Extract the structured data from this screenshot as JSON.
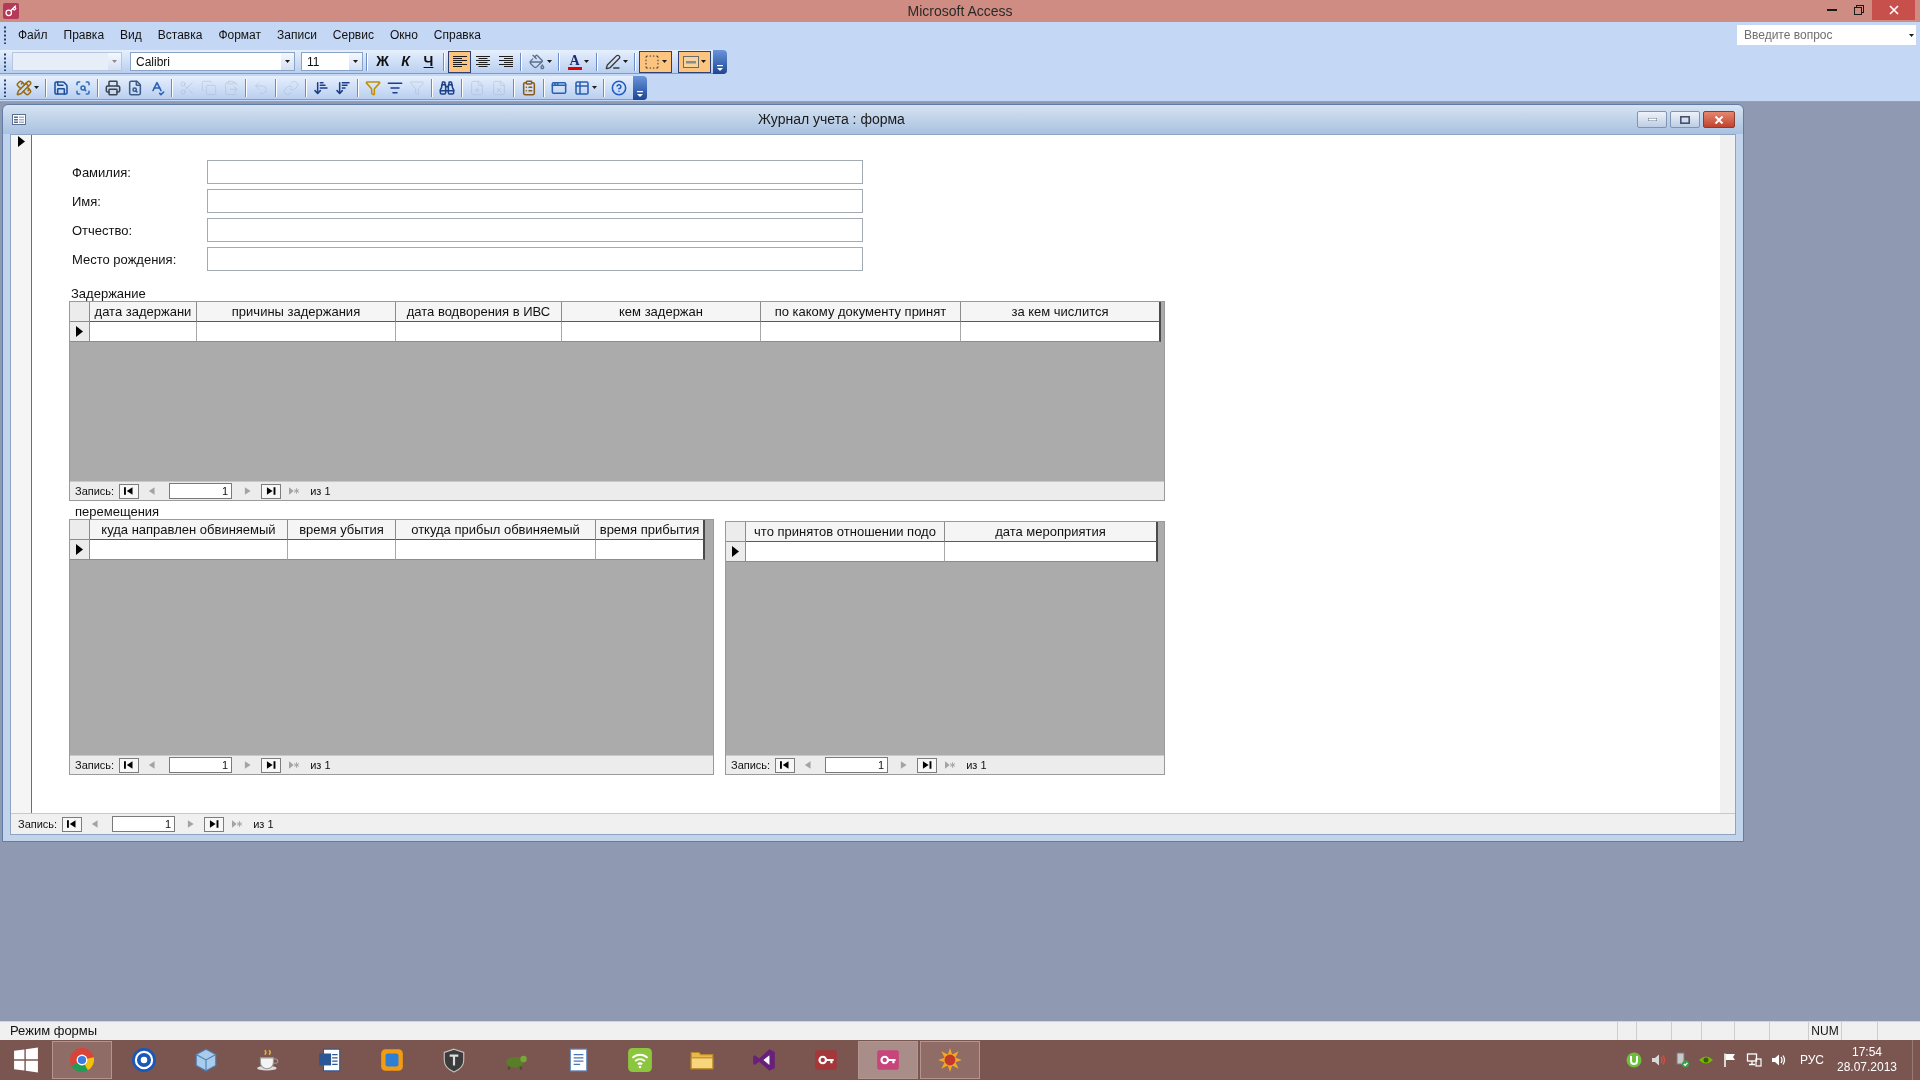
{
  "window": {
    "title": "Microsoft Access"
  },
  "menu_bar": {
    "items": [
      "Файл",
      "Правка",
      "Вид",
      "Вставка",
      "Формат",
      "Записи",
      "Сервис",
      "Окно",
      "Справка"
    ],
    "question_box": {
      "placeholder": "Введите вопрос"
    }
  },
  "formatting_toolbar": {
    "object_box": {
      "disabled": true
    },
    "font_box": {
      "value": "Calibri"
    },
    "size_box": {
      "value": "11"
    },
    "style_buttons": [
      {
        "kind": "bold",
        "label": "Ж",
        "pressed": false
      },
      {
        "kind": "italic",
        "label": "К",
        "pressed": false
      },
      {
        "kind": "underline",
        "label": "Ч",
        "pressed": false
      }
    ],
    "align_buttons": [
      {
        "pressed": true
      },
      {
        "pressed": false
      },
      {
        "pressed": false
      }
    ],
    "color_buttons": [
      {
        "pressed": false
      },
      {
        "pressed": false,
        "label": "A"
      },
      {
        "pressed": false
      },
      {
        "pressed": true
      },
      {
        "pressed": true
      }
    ]
  },
  "database_toolbar": {
    "buttons": [
      {
        "disabled": false
      },
      {
        "disabled": false
      },
      {
        "disabled": false
      },
      {
        "disabled": false
      },
      {
        "disabled": false
      },
      {
        "disabled": false
      },
      {
        "disabled": true
      },
      {
        "disabled": true
      },
      {
        "disabled": true
      },
      {
        "disabled": true
      },
      {
        "disabled": true
      },
      {
        "disabled": false
      },
      {
        "disabled": false
      },
      {
        "disabled": false
      },
      {
        "disabled": false
      },
      {
        "disabled": true
      },
      {
        "disabled": false
      },
      {
        "disabled": true
      },
      {
        "disabled": true
      },
      {
        "disabled": false
      },
      {
        "disabled": false
      },
      {
        "disabled": false
      },
      {
        "disabled": false
      }
    ]
  },
  "form_window": {
    "title": "Журнал учета : форма",
    "record_selector": {
      "current": true
    },
    "fields": [
      {
        "label": "Фамилия:"
      },
      {
        "label": "Имя:"
      },
      {
        "label": "Отчество:"
      },
      {
        "label": "Место рождения:"
      }
    ],
    "subforms": [
      {
        "caption": "Задержание",
        "columns": [
          "дата задержани",
          "причины задержания",
          "дата водворения в ИВС",
          "кем задержан",
          "по какому документу принят",
          "за кем числится"
        ],
        "rows": [
          {
            "current": true
          }
        ],
        "navigator": {
          "label": "Запись:",
          "buttons": [
            {
              "disabled": false
            },
            {
              "disabled": true
            },
            {
              "disabled": true
            },
            {
              "disabled": false
            },
            {
              "disabled": true
            }
          ],
          "value": "1",
          "total": "из 1"
        }
      },
      {
        "caption": "перемещения",
        "columns": [
          "куда направлен обвиняемый",
          "время убытия",
          "откуда прибыл обвиняемый",
          "время прибытия"
        ],
        "rows": [
          {
            "current": true
          }
        ],
        "navigator": {
          "label": "Запись:",
          "buttons": [
            {
              "disabled": false
            },
            {
              "disabled": true
            },
            {
              "disabled": true
            },
            {
              "disabled": false
            },
            {
              "disabled": true
            }
          ],
          "value": "1",
          "total": "из 1"
        }
      },
      {
        "columns": [
          "что принятов отношении подо",
          "дата мероприятия"
        ],
        "rows": [
          {
            "current": true
          }
        ],
        "navigator": {
          "label": "Запись:",
          "buttons": [
            {
              "disabled": false
            },
            {
              "disabled": true
            },
            {
              "disabled": true
            },
            {
              "disabled": false
            },
            {
              "disabled": true
            }
          ],
          "value": "1",
          "total": "из 1"
        }
      }
    ],
    "navigator": {
      "label": "Запись:",
      "buttons": [
        {
          "disabled": false
        },
        {
          "disabled": true
        },
        {
          "disabled": true
        },
        {
          "disabled": false
        },
        {
          "disabled": true
        }
      ],
      "value": "1",
      "total": "из 1"
    }
  },
  "status_bar": {
    "text": "Режим формы",
    "indicator": "NUM"
  },
  "taskbar": {
    "apps": [
      {
        "running": true,
        "selected": false
      },
      {
        "running": false,
        "selected": false
      },
      {
        "running": false,
        "selected": false
      },
      {
        "running": false,
        "selected": false
      },
      {
        "running": false,
        "selected": false
      },
      {
        "running": false,
        "selected": false
      },
      {
        "running": false,
        "selected": false
      },
      {
        "running": false,
        "selected": false
      },
      {
        "running": false,
        "selected": false
      },
      {
        "running": false,
        "selected": false
      },
      {
        "running": false,
        "selected": false
      },
      {
        "running": false,
        "selected": false
      },
      {
        "running": false,
        "selected": false
      },
      {
        "running": true,
        "selected": true
      },
      {
        "running": true,
        "selected": false
      }
    ],
    "tray": {
      "language": "РУС",
      "time": "17:54",
      "date": "28.07.2013"
    }
  }
}
